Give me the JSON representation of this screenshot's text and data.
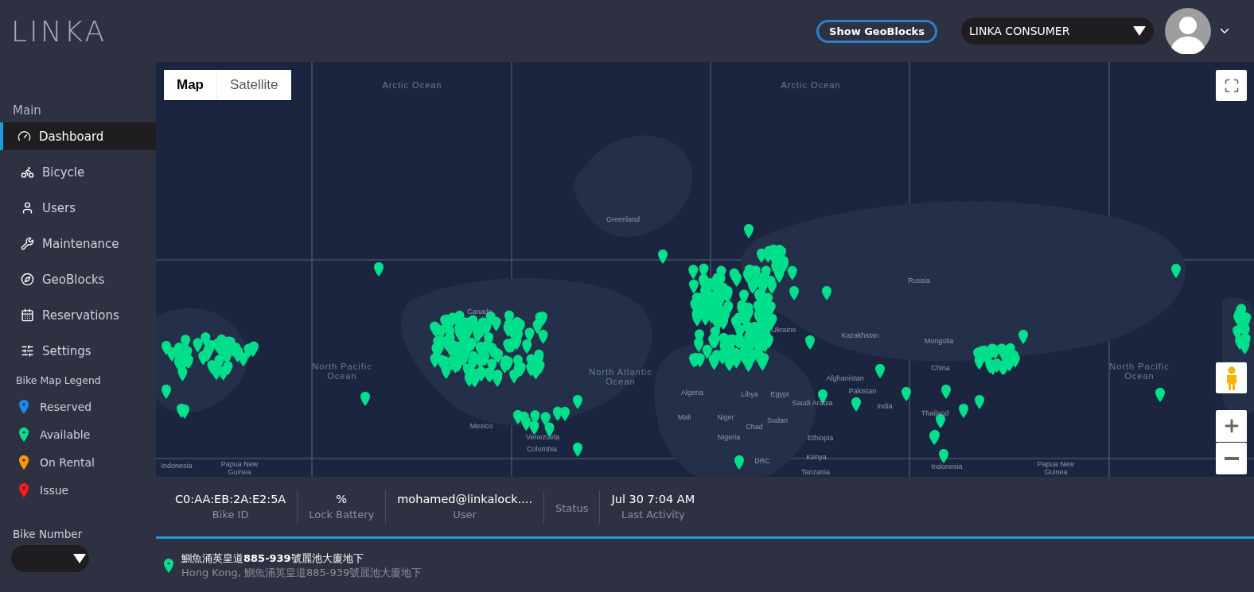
{
  "header": {
    "logo": "LINKA",
    "geoblocks_button": "Show GeoBlocks",
    "account_select": {
      "value": "LINKA CONSUMER"
    }
  },
  "sidebar": {
    "section": "Main",
    "items": [
      {
        "label": "Dashboard",
        "selected": true
      },
      {
        "label": "Bicycle",
        "selected": false
      },
      {
        "label": "Users",
        "selected": false
      },
      {
        "label": "Maintenance",
        "selected": false
      },
      {
        "label": "GeoBlocks",
        "selected": false
      },
      {
        "label": "Reservations",
        "selected": false
      },
      {
        "label": "Settings",
        "selected": false
      }
    ],
    "legend": {
      "title": "Bike Map Legend",
      "items": [
        {
          "label": "Reserved",
          "color": "#1e88e5"
        },
        {
          "label": "Available",
          "color": "#00e08c"
        },
        {
          "label": "On Rental",
          "color": "#ff9800"
        },
        {
          "label": "Issue",
          "color": "#ff1a1a"
        }
      ]
    },
    "bike_number": {
      "label": "Bike Number"
    }
  },
  "map": {
    "type_toggle": [
      {
        "label": "Map",
        "selected": true
      },
      {
        "label": "Satellite",
        "selected": false
      }
    ],
    "labels": [
      "Arctic Ocean",
      "Arctic Ocean",
      "Greenland",
      "Russia",
      "Kazakhstan",
      "Mongolia",
      "China",
      "Afghanistan",
      "Pakistan",
      "India",
      "Thailand",
      "Indonesia",
      "Papua New Guinea",
      "North Pacific Ocean",
      "North Atlantic Ocean",
      "North Pacific Ocean",
      "Algeria",
      "Libya",
      "Egypt",
      "Mali",
      "Niger",
      "Chad",
      "Sudan",
      "Nigeria",
      "Ethiopia",
      "Kenya",
      "Tanzania",
      "DRC",
      "Saudi Arabia",
      "Ukraine",
      "Canada",
      "Mexico",
      "Venezuela",
      "Colombia",
      "Indonesia",
      "Papua New Guinea"
    ]
  },
  "bike_info": {
    "fields": [
      {
        "value": "C0:AA:EB:2A:E2:5A",
        "label": "Bike ID"
      },
      {
        "value": "%",
        "label": "Lock Battery"
      },
      {
        "value": "mohamed@linkalock....",
        "label": "User"
      },
      {
        "label": "Status"
      },
      {
        "value": "Jul 30 7:04 AM",
        "label": "Last Activity"
      }
    ]
  },
  "address": {
    "title": "鰂魚涌英皇道**885-939**號麗池大廈地下",
    "subtitle": "Hong Kong, 鰂魚涌英皇道885-939號麗池大廈地下"
  }
}
